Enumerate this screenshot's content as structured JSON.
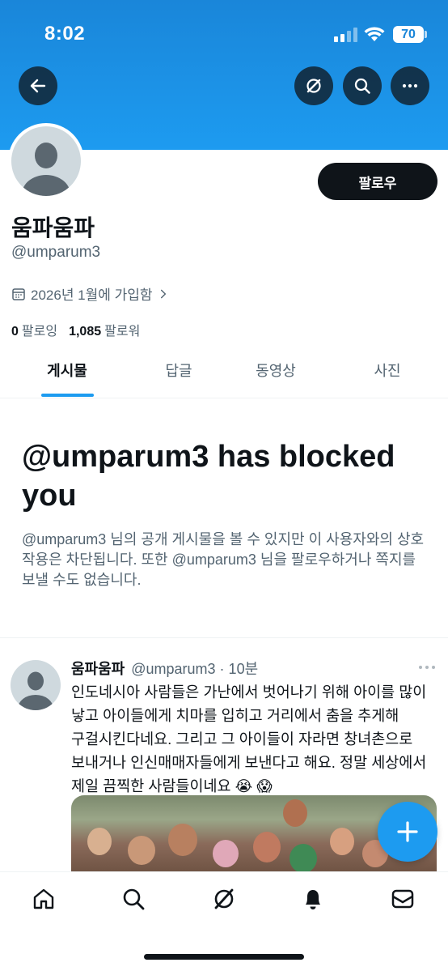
{
  "status_bar": {
    "time": "8:02",
    "battery": "70"
  },
  "colors": {
    "accent": "#1d9bf0",
    "banner": "#1a86d9",
    "text_primary": "#0f1419",
    "text_secondary": "#536471"
  },
  "header": {
    "back_icon": "arrow-left-icon",
    "grok_icon": "slash-circle-icon",
    "search_icon": "search-icon",
    "more_icon": "more-horizontal-icon"
  },
  "profile": {
    "follow_label": "팔로우",
    "display_name": "움파움파",
    "handle": "@umparum3",
    "joined": "2026년 1월에 가입함",
    "following_count": "0",
    "following_label": "팔로잉",
    "followers_count": "1,085",
    "followers_label": "팔로워"
  },
  "tabs": [
    {
      "label": "게시물",
      "active": true
    },
    {
      "label": "답글",
      "active": false
    },
    {
      "label": "동영상",
      "active": false
    },
    {
      "label": "사진",
      "active": false
    }
  ],
  "blocked": {
    "title": "@umparum3 has blocked you",
    "description": "@umparum3 님의 공개 게시물을 볼 수 있지만 이 사용자와의 상호작용은 차단됩니다. 또한 @umparum3 님을 팔로우하거나 쪽지를 보낼 수도 없습니다."
  },
  "tweet": {
    "name": "움파움파",
    "handle_time": "@umparum3 · 10분",
    "text": "인도네시아 사람들은 가난에서 벗어나기 위해 아이를 많이 낳고 아이들에게 치마를 입히고 거리에서 춤을 추게해 구걸시킨다네요. 그리고 그 아이들이 자라면 창녀촌으로 보내거나 인신매매자들에게 보낸다고 해요. 정말 세상에서 제일 끔찍한 사람들이네요 😭 😱"
  },
  "bottom_nav": [
    "home-icon",
    "search-icon",
    "grok-icon",
    "notifications-bell-icon",
    "messages-envelope-icon"
  ]
}
